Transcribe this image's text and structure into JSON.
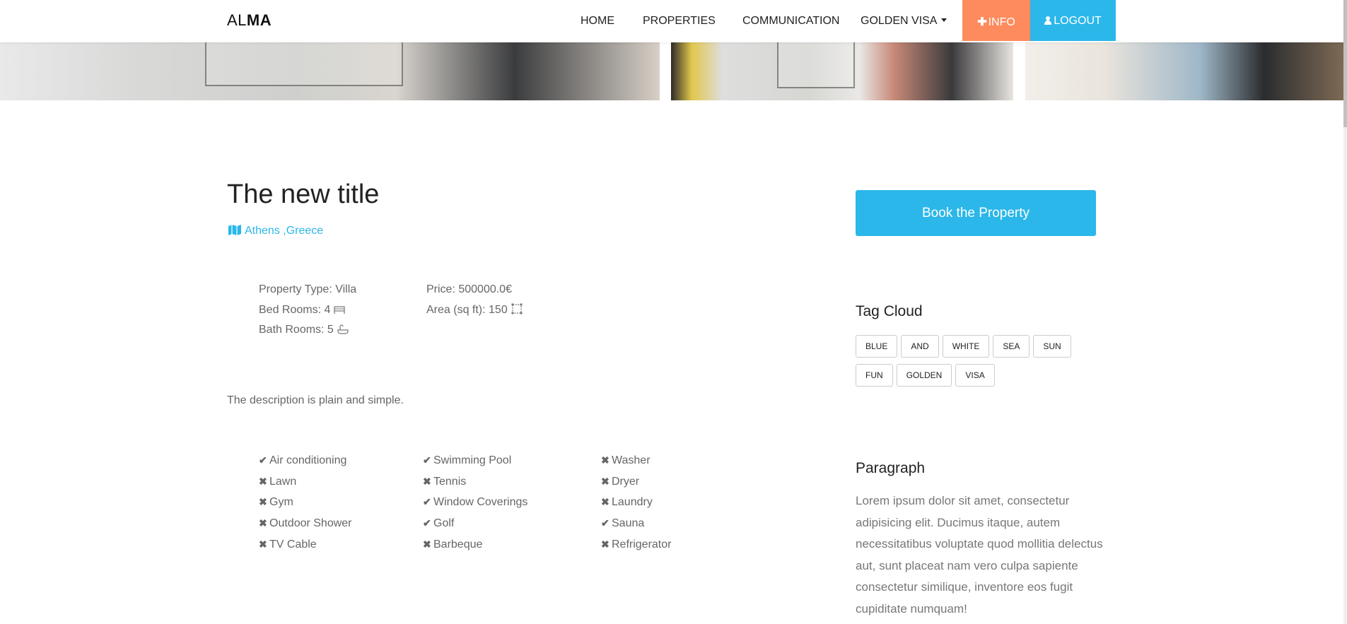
{
  "navbar": {
    "logo_part1": "AL",
    "logo_part2": "MA",
    "links": [
      "HOME",
      "PROPERTIES",
      "COMMUNICATION",
      "GOLDEN VISA"
    ],
    "info_label": "INFO",
    "logout_label": "LOGOUT",
    "info_color": "#fd8b5e",
    "logout_color": "#2bb7e9"
  },
  "property": {
    "title": "The new title",
    "location": "Athens ,Greece",
    "property_type": "Property Type: Villa",
    "bed_rooms": "Bed Rooms: 4",
    "bath_rooms": "Bath Rooms: 5",
    "price": "Price: 500000.0€",
    "area": "Area (sq ft): 150",
    "description": "The description is plain and simple."
  },
  "features": {
    "col1": [
      {
        "name": "Air conditioning",
        "available": true
      },
      {
        "name": "Lawn",
        "available": false
      },
      {
        "name": "Gym",
        "available": false
      },
      {
        "name": "Outdoor Shower",
        "available": false
      },
      {
        "name": "TV Cable",
        "available": false
      }
    ],
    "col2": [
      {
        "name": "Swimming Pool",
        "available": true
      },
      {
        "name": "Tennis",
        "available": false
      },
      {
        "name": "Window Coverings",
        "available": true
      },
      {
        "name": "Golf",
        "available": true
      },
      {
        "name": "Barbeque",
        "available": false
      }
    ],
    "col3": [
      {
        "name": "Washer",
        "available": false
      },
      {
        "name": "Dryer",
        "available": false
      },
      {
        "name": "Laundry",
        "available": false
      },
      {
        "name": "Sauna",
        "available": true
      },
      {
        "name": "Refrigerator",
        "available": false
      }
    ]
  },
  "sidebar": {
    "book_label": "Book the Property",
    "tag_cloud_heading": "Tag Cloud",
    "tags": [
      "BLUE",
      "AND",
      "WHITE",
      "SEA",
      "SUN",
      "FUN",
      "GOLDEN",
      "VISA"
    ],
    "paragraph_heading": "Paragraph",
    "paragraph_text": "Lorem ipsum dolor sit amet, consectetur adipisicing elit. Ducimus itaque, autem necessitatibus voluptate quod mollitia delectus aut, sunt placeat nam vero culpa sapiente consectetur similique, inventore eos fugit cupiditate numquam!"
  },
  "accent_color": "#2bb7e9"
}
